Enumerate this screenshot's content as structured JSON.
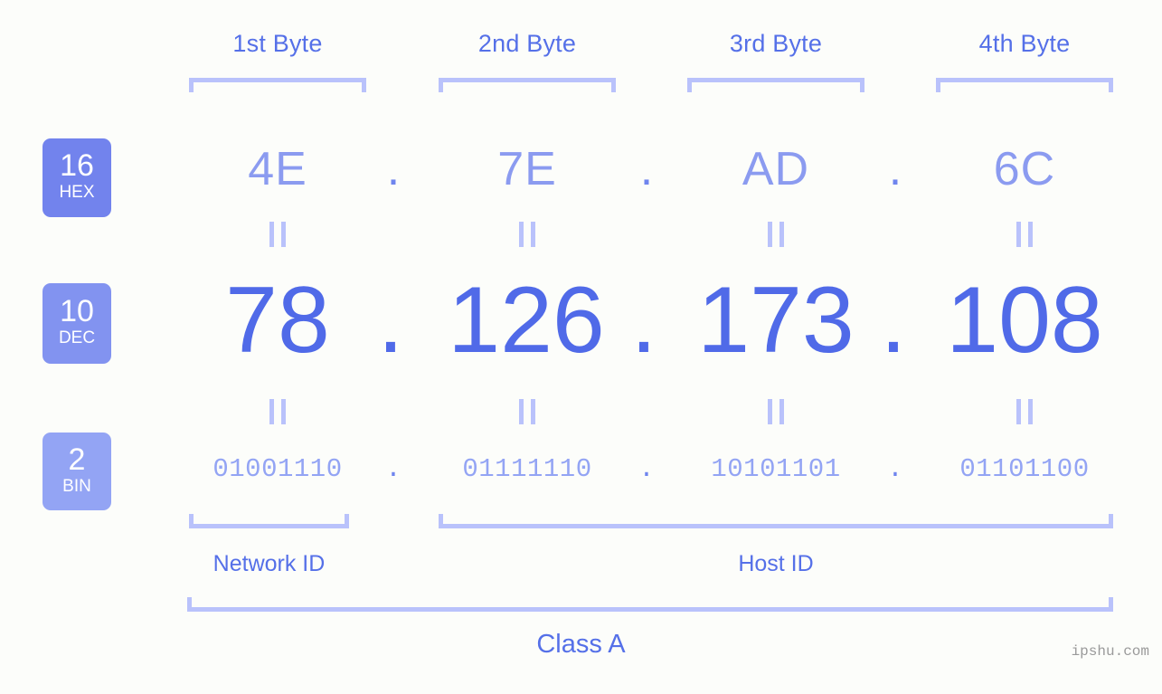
{
  "page": {
    "background_color": "#fcfdfa",
    "accent_color": "#5570e8",
    "bracket_color": "#b9c2fb",
    "watermark": "ipshu.com"
  },
  "byte_headers": [
    {
      "label": "1st Byte"
    },
    {
      "label": "2nd Byte"
    },
    {
      "label": "3rd Byte"
    },
    {
      "label": "4th Byte"
    }
  ],
  "radix_badges": [
    {
      "number": "16",
      "name": "HEX",
      "color": "#7283ed"
    },
    {
      "number": "10",
      "name": "DEC",
      "color": "#8293f0"
    },
    {
      "number": "2",
      "name": "BIN",
      "color": "#93a4f4"
    }
  ],
  "rows": {
    "hex": {
      "radix": "16",
      "radix_name": "HEX",
      "values": [
        "4E",
        "7E",
        "AD",
        "6C"
      ],
      "separator": "."
    },
    "dec": {
      "radix": "10",
      "radix_name": "DEC",
      "values": [
        "78",
        "126",
        "173",
        "108"
      ],
      "separator": ".",
      "full": "78.126.173.108"
    },
    "bin": {
      "radix": "2",
      "radix_name": "BIN",
      "values": [
        "01001110",
        "01111110",
        "10101101",
        "01101100"
      ],
      "separator": "."
    }
  },
  "equals_connectors": {
    "glyph": "=",
    "count_per_row": 4
  },
  "id_sections": [
    {
      "label": "Network ID"
    },
    {
      "label": "Host ID"
    }
  ],
  "class": {
    "label": "Class A"
  }
}
